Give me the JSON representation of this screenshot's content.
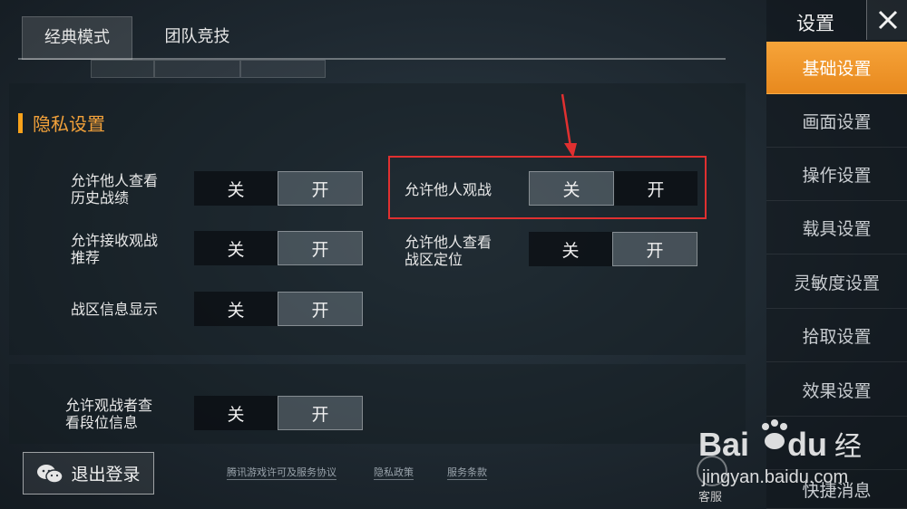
{
  "tabs": [
    {
      "label": "经典模式",
      "active": true
    },
    {
      "label": "团队竞技",
      "active": false
    }
  ],
  "section": {
    "title": "隐私设置"
  },
  "settings": [
    {
      "label_line1": "允许他人查看",
      "label_line2": "历史战绩",
      "off": "关",
      "on": "开",
      "state": "on"
    },
    {
      "label_line1": "允许接收观战",
      "label_line2": "推荐",
      "off": "关",
      "on": "开",
      "state": "on"
    },
    {
      "label_line1": "战区信息显示",
      "label_line2": "",
      "off": "关",
      "on": "开",
      "state": "on"
    },
    {
      "label_line1": "允许他人观战",
      "label_line2": "",
      "off": "关",
      "on": "开",
      "state": "off"
    },
    {
      "label_line1": "允许他人查看",
      "label_line2": "战区定位",
      "off": "关",
      "on": "开",
      "state": "on"
    },
    {
      "label_line1": "允许观战者查",
      "label_line2": "看段位信息",
      "off": "关",
      "on": "开",
      "state": "on"
    }
  ],
  "bottom": {
    "logout": "退出登录",
    "links": [
      "腾讯游戏许可及服务协议",
      "隐私政策",
      "服务条款"
    ],
    "kefu": "客服"
  },
  "sidebar": {
    "title": "设置",
    "items": [
      "基础设置",
      "画面设置",
      "操作设置",
      "载具设置",
      "灵敏度设置",
      "拾取设置",
      "效果设置",
      "",
      "快捷消息"
    ]
  },
  "watermark": {
    "brand": "Baidu经验",
    "url": "jingyan.baidu.com"
  },
  "colors": {
    "accent": "#f7a21b",
    "highlight": "#e03030"
  }
}
